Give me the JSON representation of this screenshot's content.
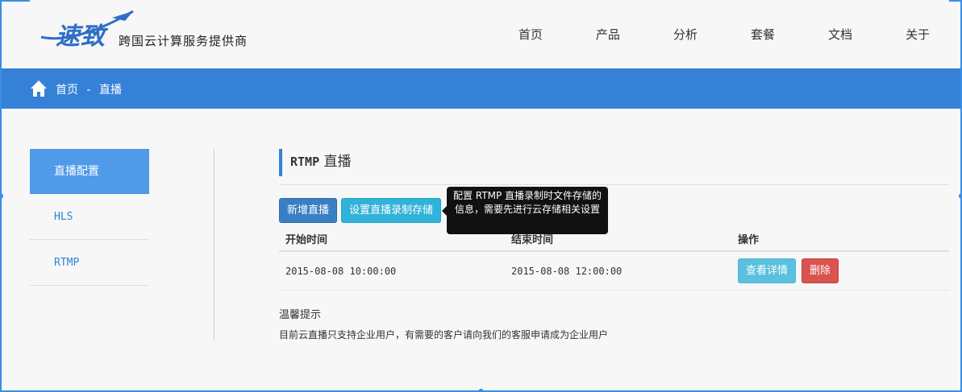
{
  "header": {
    "logo_text": "速致",
    "slogan": "跨国云计算服务提供商",
    "nav": [
      "首页",
      "产品",
      "分析",
      "套餐",
      "文档",
      "关于"
    ]
  },
  "breadcrumb": {
    "home": "首页",
    "separator": "-",
    "current": "直播"
  },
  "sidebar": {
    "items": [
      {
        "label": "直播配置",
        "active": true
      },
      {
        "label": "HLS",
        "active": false
      },
      {
        "label": "RTMP",
        "active": false
      }
    ]
  },
  "main": {
    "title_prefix": "RTMP",
    "title_suffix": "直播",
    "buttons": {
      "add": "新增直播",
      "storage": "设置直播录制存储"
    },
    "tooltip": "配置 RTMP 直播录制时文件存储的信息，需要先进行云存储相关设置",
    "table": {
      "headers": [
        "开始时间",
        "结束时间",
        "操作"
      ],
      "rows": [
        {
          "start": "2015-08-08 10:00:00",
          "end": "2015-08-08 12:00:00",
          "view": "查看详情",
          "delete": "删除"
        }
      ]
    },
    "notice": {
      "title": "温馨提示",
      "text": "目前云直播只支持企业用户，有需要的客户请向我们的客服申请成为企业用户"
    }
  },
  "colors": {
    "brand": "#3581d8",
    "selection": "#3a8ee6",
    "danger": "#d9534f",
    "info": "#5bc0de"
  }
}
